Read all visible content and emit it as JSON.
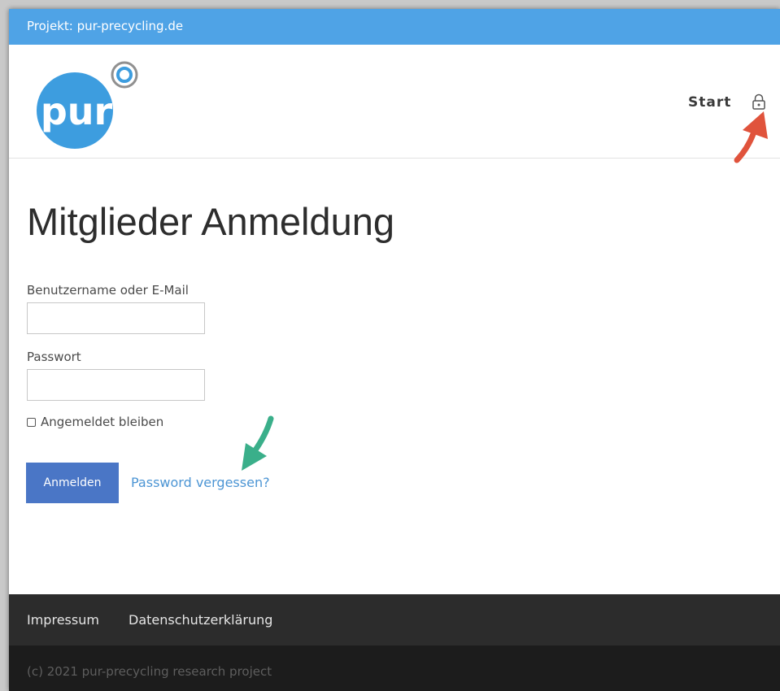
{
  "topbar": {
    "project_label": "Projekt: pur-precycling.de"
  },
  "logo": {
    "text": "pur",
    "color": "#3d9ddf",
    "ring_color": "#909090"
  },
  "nav": {
    "start_label": "Start",
    "lock_icon": "lock-icon"
  },
  "main": {
    "heading": "Mitglieder Anmeldung",
    "username_label": "Benutzername oder E-Mail",
    "username_value": "",
    "password_label": "Passwort",
    "password_value": "",
    "remember_label": "Angemeldet bleiben",
    "login_button": "Anmelden",
    "forgot_link": "Password vergessen?"
  },
  "footer": {
    "links": [
      "Impressum",
      "Datenschutzerklärung"
    ],
    "copyright": "(c) 2021 pur-precycling research project"
  },
  "colors": {
    "topbar": "#4fa3e6",
    "button": "#4a76c6",
    "link": "#4c95d4",
    "footer_top": "#2c2c2c",
    "footer_bottom": "#1c1c1c",
    "arrow_red": "#e0533c",
    "arrow_green": "#3aaf8a"
  }
}
